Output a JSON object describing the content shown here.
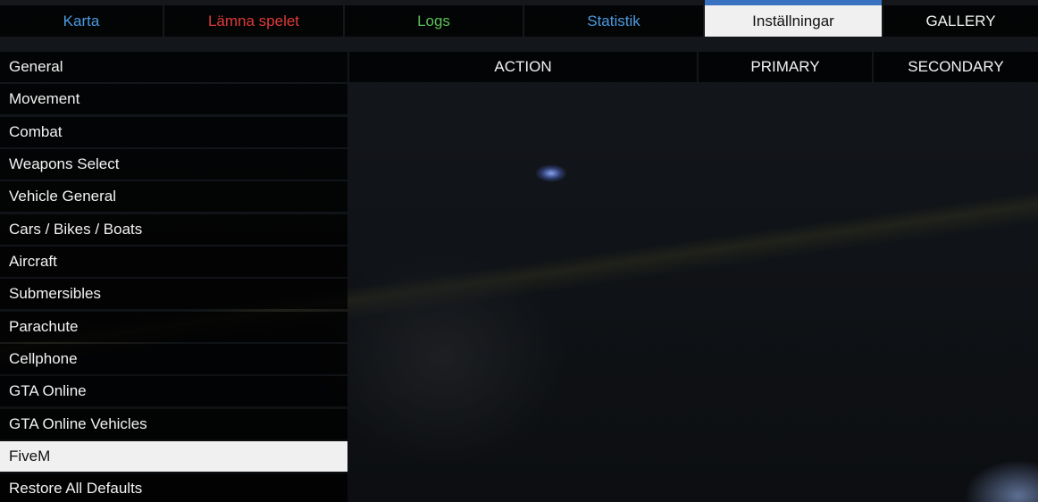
{
  "tabs": [
    {
      "label": "Karta",
      "color": "#4a9be0",
      "active": false
    },
    {
      "label": "Lämna spelet",
      "color": "#e03a3a",
      "active": false
    },
    {
      "label": "Logs",
      "color": "#5cbf5c",
      "active": false
    },
    {
      "label": "Statistik",
      "color": "#4a9be0",
      "active": false
    },
    {
      "label": "Inställningar",
      "color": "#111111",
      "active": true
    },
    {
      "label": "GALLERY",
      "color": "#f2f2f2",
      "active": false
    }
  ],
  "active_tab_accent": "#3a72c2",
  "menu": {
    "items": [
      {
        "label": "General"
      },
      {
        "label": "Movement"
      },
      {
        "label": "Combat"
      },
      {
        "label": "Weapons Select"
      },
      {
        "label": "Vehicle General"
      },
      {
        "label": "Cars / Bikes / Boats"
      },
      {
        "label": "Aircraft"
      },
      {
        "label": "Submersibles"
      },
      {
        "label": "Parachute"
      },
      {
        "label": "Cellphone"
      },
      {
        "label": "GTA Online"
      },
      {
        "label": "GTA Online Vehicles"
      },
      {
        "label": "FiveM"
      },
      {
        "label": "Restore All Defaults"
      }
    ],
    "selected_index": 12
  },
  "table": {
    "columns": [
      "ACTION",
      "PRIMARY",
      "SECONDARY"
    ]
  }
}
